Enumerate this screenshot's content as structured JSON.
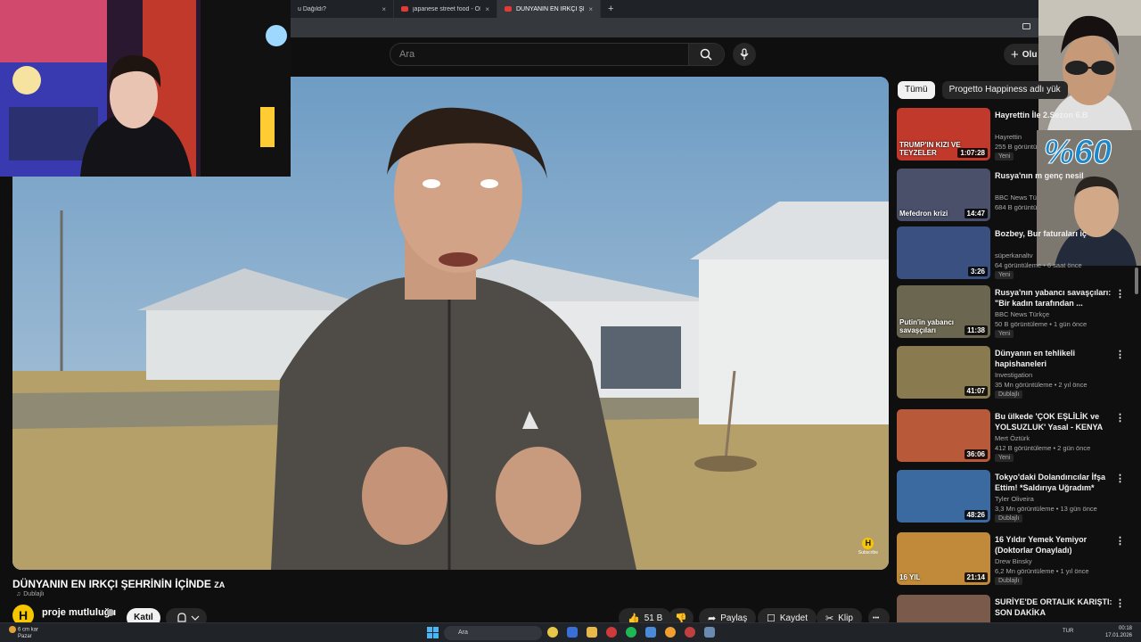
{
  "browser": {
    "tabs": [
      {
        "title": "u Dağıldı?",
        "active": false
      },
      {
        "title": "japanese street food - OKONOMIYAKI",
        "active": false
      },
      {
        "title": "DÜNYANIN EN IRKÇI ŞEHRİNİN İÇİNDE",
        "active": true
      }
    ],
    "new_tab": "+",
    "close_glyph": "×"
  },
  "header": {
    "search_placeholder": "Ara",
    "create_label": "Olu"
  },
  "player": {
    "watermark_letter": "H",
    "watermark_text": "Subscribe"
  },
  "video": {
    "title": "DÜNYANIN EN IRKÇI ŞEHRİNİN İÇİNDE",
    "title_suffix": "ZA",
    "dub_badge": "Dublajlı",
    "channel_initial": "H",
    "channel_name": "proje mutluluğu",
    "join_label": "Katıl",
    "likes": "51 B",
    "share": "Paylaş",
    "save": "Kaydet",
    "clip": "Klip",
    "more": "•••"
  },
  "overlay": {
    "percent": "%60"
  },
  "sidebar": {
    "chips": [
      {
        "label": "Tümü",
        "active": true
      },
      {
        "label": "Progetto Happiness adlı yük",
        "active": false
      }
    ],
    "items": [
      {
        "title": "Hayrettin İle 2.Sezon 6.B",
        "channel": "Hayrettin",
        "meta": "255 B görüntü",
        "badge": "Yeni",
        "duration": "1:07:28",
        "overlay": "TRUMP'IN KIZI VE TEYZELER",
        "thumb_color": "#c0392b"
      },
      {
        "title": "Rusya'nın m genç nesil",
        "channel": "BBC News Tü",
        "meta": "684 B görüntü",
        "badge": "",
        "duration": "14:47",
        "overlay": "Mefedron krizi",
        "thumb_color": "#4a4f6a"
      },
      {
        "title": "Bozbey, Bur faturaları iç",
        "channel": "süperkanaltv",
        "meta": "64 görüntüleme • 6 saat önce",
        "badge": "Yeni",
        "duration": "3:26",
        "overlay": "",
        "thumb_color": "#3a5080"
      },
      {
        "title": "Rusya'nın yabancı savaşçıları: \"Bir kadın tarafından ...",
        "channel": "BBC News Türkçe",
        "meta": "50 B görüntüleme • 1 gün önce",
        "badge": "Yeni",
        "duration": "11:38",
        "overlay": "Putin'in yabancı savaşçıları",
        "thumb_color": "#6b6650"
      },
      {
        "title": "Dünyanın en tehlikeli hapishaneleri",
        "channel": "Investigation",
        "meta": "35 Mn görüntüleme • 2 yıl önce",
        "badge": "Dublajlı",
        "duration": "41:07",
        "overlay": "",
        "thumb_color": "#8a7a50"
      },
      {
        "title": "Bu ülkede 'ÇOK EŞLİLİK ve YOLSUZLUK' Yasal - KENYA",
        "channel": "Mert Öztürk",
        "meta": "412 B görüntüleme • 2 gün önce",
        "badge": "Yeni",
        "duration": "36:06",
        "overlay": "",
        "thumb_color": "#b85a3a"
      },
      {
        "title": "Tokyo'daki Dolandırıcılar İfşa Ettim! *Saldırıya Uğradım*",
        "channel": "Tyler Oliveira",
        "meta": "3,3 Mn görüntüleme • 13 gün önce",
        "badge": "Dublajlı",
        "duration": "48:26",
        "overlay": "",
        "thumb_color": "#3a6aa0"
      },
      {
        "title": "16 Yıldır Yemek Yemiyor (Doktorlar Onayladı)",
        "channel": "Drew Binsky",
        "meta": "6,2 Mn görüntüleme • 1 yıl önce",
        "badge": "Dublajlı",
        "duration": "21:14",
        "overlay": "16 YIL",
        "thumb_color": "#c08a3a"
      },
      {
        "title": "SURİYE'DE ORTALIK KARIŞTI: SON DAKİKA",
        "channel": "",
        "meta": "",
        "badge": "",
        "duration": "",
        "overlay": "",
        "thumb_color": "#7a5a4a"
      }
    ],
    "kebab": "⋮"
  },
  "taskbar": {
    "weather_temp": "6 cm kar",
    "weather_desc": "Pazar",
    "search_placeholder": "Ara",
    "lang": "TUR",
    "time": "00:18",
    "date": "17.01.2026"
  }
}
